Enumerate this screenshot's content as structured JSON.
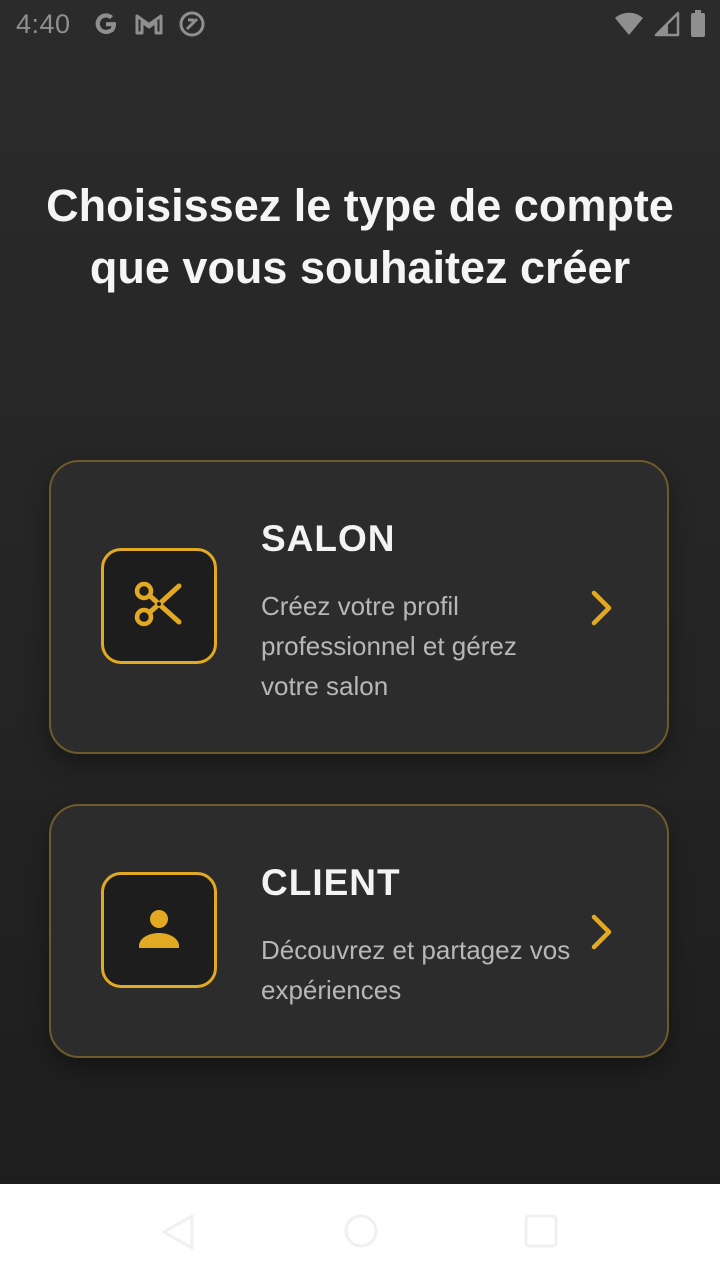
{
  "status_bar": {
    "time": "4:40",
    "left_icons": [
      "google-icon",
      "gmail-icon",
      "sync-icon"
    ],
    "right_icons": [
      "wifi-icon",
      "signal-icon",
      "battery-icon"
    ]
  },
  "page": {
    "title": "Choisissez le type de compte que vous souhaitez créer"
  },
  "cards": {
    "salon": {
      "title": "SALON",
      "description": "Créez votre profil professionnel et gérez votre salon",
      "icon": "scissors-icon"
    },
    "client": {
      "title": "CLIENT",
      "description": "Découvrez et partagez vos expériences",
      "icon": "person-icon"
    }
  },
  "nav_bar": {
    "icons": [
      "back-icon",
      "home-icon",
      "recents-icon"
    ]
  },
  "colors": {
    "accent": "#e2a922",
    "card_border": "#6e5a2a",
    "card_background": "#2c2c2c",
    "background": "#262626",
    "title_text": "#f5f5f5",
    "description_text": "#b7b7b7"
  }
}
